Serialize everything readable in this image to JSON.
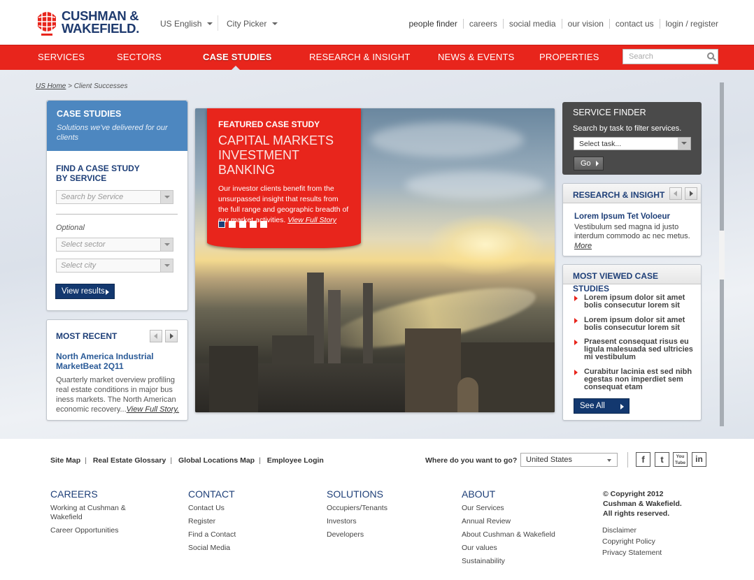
{
  "brand": {
    "line1": "CUSHMAN &",
    "line2": "WAKEFIELD.",
    "primary_color": "#e8251c",
    "navy_color": "#1e3f78"
  },
  "header": {
    "language": "US  English",
    "city_picker": "City Picker",
    "top_links": [
      "people finder",
      "careers",
      "social media",
      "our vision",
      "contact us",
      "login / register"
    ]
  },
  "nav": {
    "items": [
      "SERVICES",
      "SECTORS",
      "CASE STUDIES",
      "RESEARCH & INSIGHT",
      "NEWS & EVENTS",
      "PROPERTIES"
    ],
    "active": "CASE STUDIES",
    "search_placeholder": "Search"
  },
  "breadcrumb": {
    "home": "US Home",
    "separator": ">",
    "current": "Client Successes"
  },
  "case_studies": {
    "title": "CASE STUDIES",
    "subtitle": "Solutions we've delivered for our clients",
    "find_title": "FIND A CASE STUDY BY SERVICE",
    "service_placeholder": "Search by Service",
    "optional_label": "Optional",
    "sector_placeholder": "Select sector",
    "city_placeholder": "Select city",
    "view_results": "View results"
  },
  "most_recent": {
    "title": "MOST RECENT",
    "item_title": "North America Industrial MarketBeat 2Q11",
    "item_text": "Quarterly market overview profiling real estate conditions in major bus iness markets. The North American economic recovery...",
    "link": "View Full Story."
  },
  "featured": {
    "kicker": "FEATURED CASE STUDY",
    "headline": "CAPITAL MARKETS INVESTMENT BANKING",
    "text": "Our investor clients benefit from the unsurpassed insight that results from the full range and geographic breadth of our market activities.",
    "link": "View Full Story",
    "slides": 5,
    "active_slide": 1
  },
  "service_finder": {
    "title": "SERVICE FINDER",
    "subtitle": "Search by task to filter services.",
    "select_value": "Select task...",
    "go": "Go"
  },
  "research": {
    "title": "RESEARCH & INSIGHT",
    "item_title": "Lorem Ipsum Tet Voloeur",
    "item_text": "Vestibulum sed magna id justo interdum commodo ac nec metus.",
    "more": "More"
  },
  "most_viewed": {
    "title": "MOST VIEWED CASE STUDIES",
    "items": [
      "Lorem ipsum dolor sit amet bolis consecutur lorem sit",
      "Lorem ipsum dolor sit amet bolis consecutur lorem sit",
      "Praesent consequat risus eu ligula malesuada sed ultricies mi vestibulum",
      "Curabitur lacinia est sed nibh egestas non imperdiet sem consequat etam"
    ],
    "see_all": "See All"
  },
  "footer": {
    "links": [
      "Site Map",
      "Real Estate Glossary",
      "Global Locations Map",
      "Employee Login"
    ],
    "where_label": "Where do you want to go?",
    "country": "United States",
    "social": [
      "f",
      "t",
      "You Tube",
      "in"
    ],
    "columns": [
      {
        "heading": "CAREERS",
        "items": [
          "Working at Cushman & Wakefield",
          "Career Opportunities"
        ]
      },
      {
        "heading": "CONTACT",
        "items": [
          "Contact Us",
          "Register",
          "Find a Contact",
          "Social Media"
        ]
      },
      {
        "heading": "SOLUTIONS",
        "items": [
          "Occupiers/Tenants",
          "Investors",
          "Developers"
        ]
      },
      {
        "heading": "ABOUT",
        "items": [
          "Our Services",
          "Annual Review",
          "About Cushman & Wakefield",
          "Our values",
          "Sustainability"
        ]
      }
    ],
    "copyright": [
      "© Copyright 2012",
      "Cushman & Wakefield.",
      "All rights reserved."
    ],
    "legal": [
      "Disclaimer",
      "Copyright Policy",
      "Privacy Statement"
    ]
  }
}
